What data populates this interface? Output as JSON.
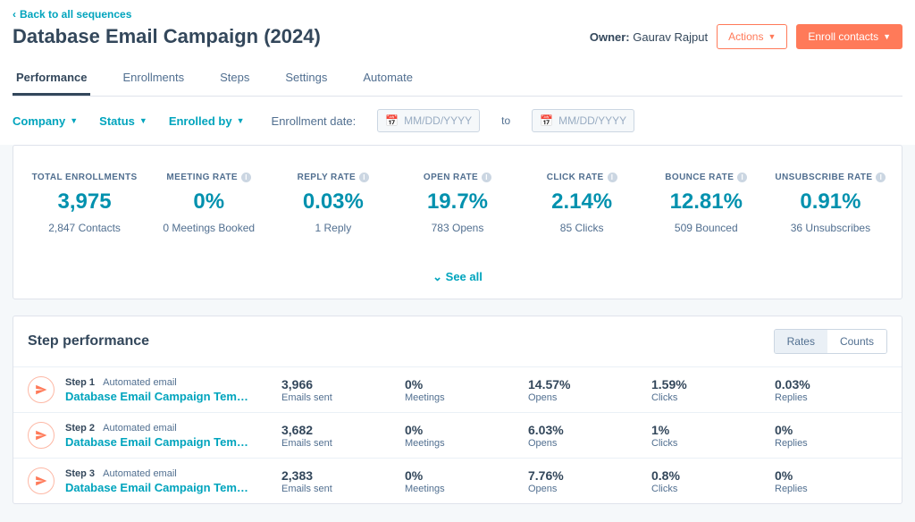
{
  "back_link": "Back to all sequences",
  "title": "Database Email Campaign (2024)",
  "owner": {
    "label": "Owner:",
    "name": "Gaurav Rajput"
  },
  "buttons": {
    "actions": "Actions",
    "enroll": "Enroll contacts"
  },
  "tabs": [
    "Performance",
    "Enrollments",
    "Steps",
    "Settings",
    "Automate"
  ],
  "filters": {
    "company": "Company",
    "status": "Status",
    "enrolled_by": "Enrolled by",
    "date_label": "Enrollment date:",
    "placeholder": "MM/DD/YYYY",
    "to": "to"
  },
  "metrics": [
    {
      "label": "TOTAL ENROLLMENTS",
      "value": "3,975",
      "sub": "2,847 Contacts",
      "info": false
    },
    {
      "label": "MEETING RATE",
      "value": "0%",
      "sub": "0 Meetings Booked",
      "info": true
    },
    {
      "label": "REPLY RATE",
      "value": "0.03%",
      "sub": "1 Reply",
      "info": true
    },
    {
      "label": "OPEN RATE",
      "value": "19.7%",
      "sub": "783 Opens",
      "info": true
    },
    {
      "label": "CLICK RATE",
      "value": "2.14%",
      "sub": "85 Clicks",
      "info": true
    },
    {
      "label": "BOUNCE RATE",
      "value": "12.81%",
      "sub": "509 Bounced",
      "info": true
    },
    {
      "label": "UNSUBSCRIBE RATE",
      "value": "0.91%",
      "sub": "36 Unsubscribes",
      "info": true
    }
  ],
  "see_all": "See all",
  "step_perf_title": "Step performance",
  "toggle": {
    "rates": "Rates",
    "counts": "Counts"
  },
  "step_type": "Automated email",
  "step_cols": [
    "Emails sent",
    "Meetings",
    "Opens",
    "Clicks",
    "Replies"
  ],
  "steps": [
    {
      "num": "Step 1",
      "name": "Database Email Campaign Tem…",
      "vals": [
        "3,966",
        "0%",
        "14.57%",
        "1.59%",
        "0.03%"
      ]
    },
    {
      "num": "Step 2",
      "name": "Database Email Campaign Tem…",
      "vals": [
        "3,682",
        "0%",
        "6.03%",
        "1%",
        "0%"
      ]
    },
    {
      "num": "Step 3",
      "name": "Database Email Campaign Tem…",
      "vals": [
        "2,383",
        "0%",
        "7.76%",
        "0.8%",
        "0%"
      ]
    }
  ]
}
